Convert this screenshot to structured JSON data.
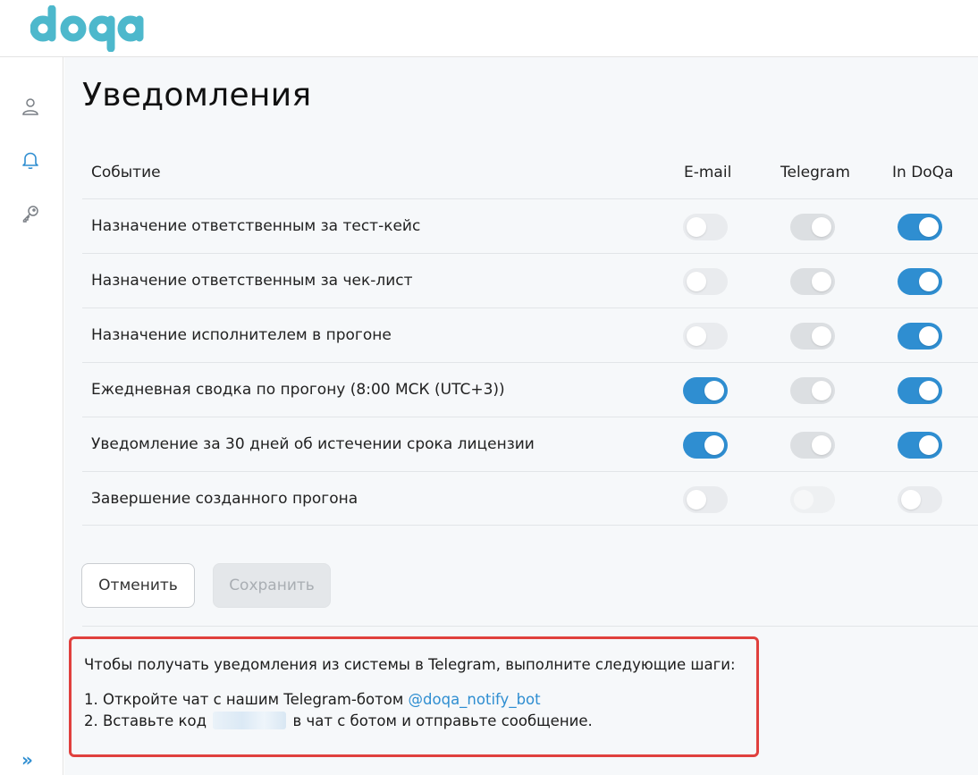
{
  "app": {
    "logo_text": "doqa",
    "brand_color": "#4db8cc",
    "accent_color": "#2f8ed1",
    "highlight_color": "#e0403d"
  },
  "sidebar": {
    "items": [
      {
        "icon": "user-icon"
      },
      {
        "icon": "bell-icon",
        "active": true
      },
      {
        "icon": "key-icon"
      }
    ],
    "expand_icon": "»"
  },
  "page": {
    "title": "Уведомления"
  },
  "table": {
    "columns": {
      "event": "Событие",
      "email": "E-mail",
      "telegram": "Telegram",
      "doqa": "In DoQa"
    },
    "rows": [
      {
        "label": "Назначение ответственным за тест-кейс",
        "email": "off",
        "telegram": "disabled",
        "doqa": "on"
      },
      {
        "label": "Назначение ответственным за чек-лист",
        "email": "off",
        "telegram": "disabled",
        "doqa": "on"
      },
      {
        "label": "Назначение исполнителем в прогоне",
        "email": "off",
        "telegram": "disabled",
        "doqa": "on"
      },
      {
        "label": "Ежедневная сводка по прогону (8:00 МСК (UTC+3))",
        "email": "on",
        "telegram": "disabled",
        "doqa": "on"
      },
      {
        "label": "Уведомление за 30 дней об истечении срока лицензии",
        "email": "on",
        "telegram": "disabled",
        "doqa": "on"
      },
      {
        "label": "Завершение созданного прогона",
        "email": "off",
        "telegram": "faint",
        "doqa": "off"
      }
    ]
  },
  "actions": {
    "cancel_label": "Отменить",
    "save_label": "Сохранить"
  },
  "telegram_info": {
    "intro": "Чтобы получать уведомления из системы в Telegram, выполните следующие шаги:",
    "step1_prefix": "1. Откройте чат с нашим Telegram-ботом ",
    "bot_link": "@doqa_notify_bot",
    "step2_prefix": "2. Вставьте код",
    "step2_suffix": "в чат с ботом и отправьте сообщение."
  }
}
